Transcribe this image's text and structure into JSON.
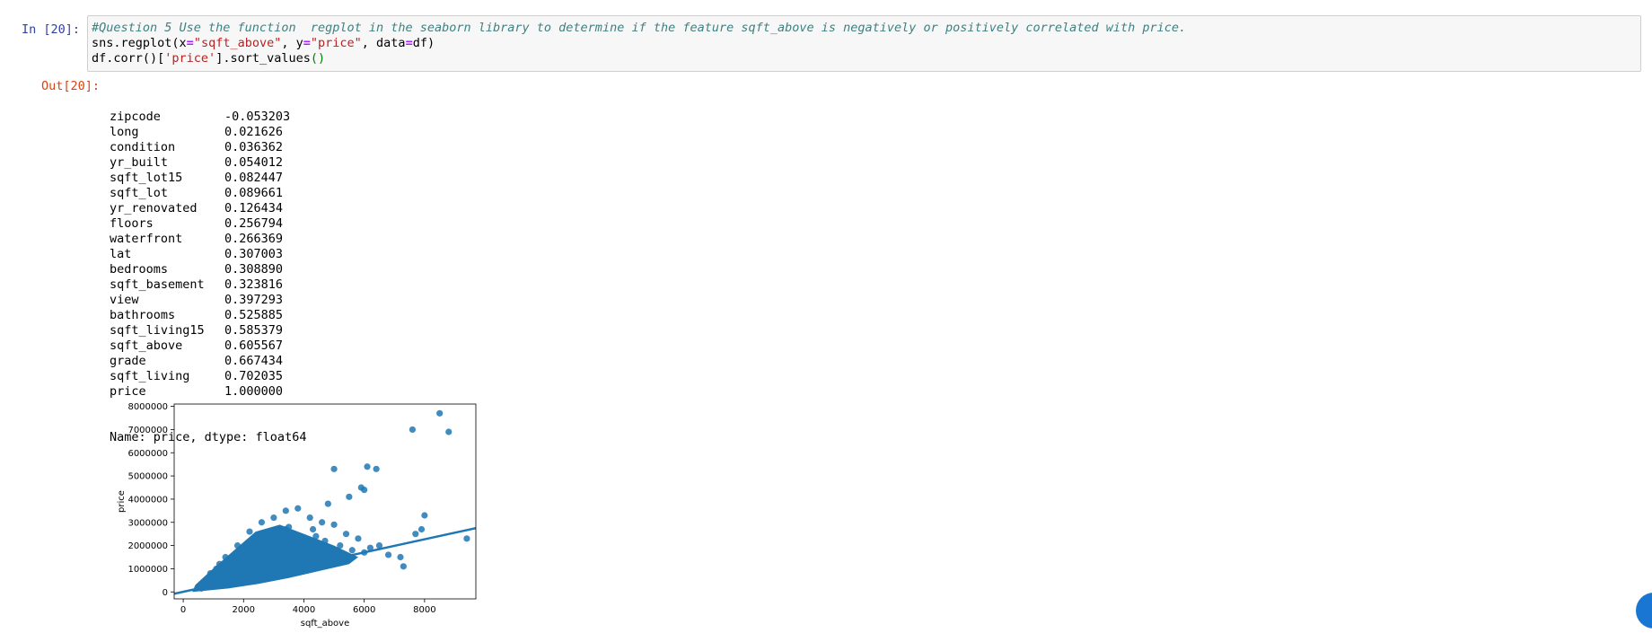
{
  "cell": {
    "in_prompt": "In [20]:",
    "out_prompt": "Out[20]:",
    "code": {
      "comment": "#Question 5 Use the function  regplot in the seaborn library to determine if the feature sqft_above is negatively or positively correlated with price.",
      "line2_a": "sns.regplot(x",
      "line2_eq1": "=",
      "line2_s1": "\"sqft_above\"",
      "line2_b": ", y",
      "line2_eq2": "=",
      "line2_s2": "\"price\"",
      "line2_c": ", data",
      "line2_eq3": "=",
      "line2_d": "df)",
      "line3_a": "df.corr()[",
      "line3_s": "'price'",
      "line3_b": "].sort_values",
      "line3_p": "()"
    }
  },
  "output": {
    "rows": [
      {
        "name": "zipcode",
        "value": "-0.053203"
      },
      {
        "name": "long",
        "value": "0.021626"
      },
      {
        "name": "condition",
        "value": "0.036362"
      },
      {
        "name": "yr_built",
        "value": "0.054012"
      },
      {
        "name": "sqft_lot15",
        "value": "0.082447"
      },
      {
        "name": "sqft_lot",
        "value": "0.089661"
      },
      {
        "name": "yr_renovated",
        "value": "0.126434"
      },
      {
        "name": "floors",
        "value": "0.256794"
      },
      {
        "name": "waterfront",
        "value": "0.266369"
      },
      {
        "name": "lat",
        "value": "0.307003"
      },
      {
        "name": "bedrooms",
        "value": "0.308890"
      },
      {
        "name": "sqft_basement",
        "value": "0.323816"
      },
      {
        "name": "view",
        "value": "0.397293"
      },
      {
        "name": "bathrooms",
        "value": "0.525885"
      },
      {
        "name": "sqft_living15",
        "value": "0.585379"
      },
      {
        "name": "sqft_above",
        "value": "0.605567"
      },
      {
        "name": "grade",
        "value": "0.667434"
      },
      {
        "name": "sqft_living",
        "value": "0.702035"
      },
      {
        "name": "price",
        "value": "1.000000"
      }
    ],
    "footer": "Name: price, dtype: float64"
  },
  "chart_data": {
    "type": "scatter",
    "xlabel": "sqft_above",
    "ylabel": "price",
    "xlim": [
      -300,
      9700
    ],
    "ylim": [
      -300000,
      8100000
    ],
    "x_ticks": [
      0,
      2000,
      4000,
      6000,
      8000
    ],
    "x_tick_labels": [
      "0",
      "2000",
      "4000",
      "6000",
      "8000"
    ],
    "y_ticks": [
      0,
      1000000,
      2000000,
      3000000,
      4000000,
      5000000,
      6000000,
      7000000,
      8000000
    ],
    "y_tick_labels": [
      "0",
      "1000000",
      "2000000",
      "3000000",
      "4000000",
      "5000000",
      "6000000",
      "7000000",
      "8000000"
    ],
    "point_color": "#1f77b4",
    "regression_line": {
      "x": [
        -300,
        9700
      ],
      "y": [
        -80000,
        2750000
      ]
    },
    "points": [
      [
        600,
        150000
      ],
      [
        700,
        200000
      ],
      [
        800,
        250000
      ],
      [
        900,
        300000
      ],
      [
        1000,
        350000
      ],
      [
        1100,
        400000
      ],
      [
        1200,
        500000
      ],
      [
        1300,
        600000
      ],
      [
        1400,
        700000
      ],
      [
        1500,
        800000
      ],
      [
        1600,
        900000
      ],
      [
        1700,
        1000000
      ],
      [
        1800,
        1100000
      ],
      [
        1900,
        1200000
      ],
      [
        2000,
        1300000
      ],
      [
        2100,
        1400000
      ],
      [
        2200,
        1500000
      ],
      [
        2300,
        1600000
      ],
      [
        2400,
        1700000
      ],
      [
        2500,
        1800000
      ],
      [
        2600,
        1900000
      ],
      [
        2700,
        2000000
      ],
      [
        2800,
        2100000
      ],
      [
        2900,
        2200000
      ],
      [
        3000,
        2300000
      ],
      [
        3100,
        2400000
      ],
      [
        3200,
        2500000
      ],
      [
        3300,
        2600000
      ],
      [
        3400,
        2700000
      ],
      [
        3500,
        2800000
      ],
      [
        1500,
        300000
      ],
      [
        2000,
        500000
      ],
      [
        2500,
        700000
      ],
      [
        3000,
        900000
      ],
      [
        3500,
        1100000
      ],
      [
        4000,
        1300000
      ],
      [
        4500,
        1500000
      ],
      [
        5000,
        1700000
      ],
      [
        1800,
        2000000
      ],
      [
        2200,
        2600000
      ],
      [
        2600,
        3000000
      ],
      [
        3000,
        3200000
      ],
      [
        3400,
        3500000
      ],
      [
        3800,
        3600000
      ],
      [
        4200,
        3200000
      ],
      [
        4600,
        3000000
      ],
      [
        5000,
        2900000
      ],
      [
        5400,
        2500000
      ],
      [
        5800,
        2300000
      ],
      [
        6200,
        1900000
      ],
      [
        4800,
        3800000
      ],
      [
        5500,
        4100000
      ],
      [
        5900,
        4500000
      ],
      [
        6100,
        5400000
      ],
      [
        6400,
        5300000
      ],
      [
        5000,
        5300000
      ],
      [
        6000,
        4400000
      ],
      [
        6800,
        1600000
      ],
      [
        7200,
        1500000
      ],
      [
        7300,
        1100000
      ],
      [
        7700,
        2500000
      ],
      [
        7900,
        2700000
      ],
      [
        8000,
        3300000
      ],
      [
        9400,
        2300000
      ],
      [
        7600,
        7000000
      ],
      [
        8500,
        7700000
      ],
      [
        8800,
        6900000
      ],
      [
        4200,
        2100000
      ],
      [
        3700,
        1900000
      ],
      [
        4400,
        2400000
      ],
      [
        1200,
        1200000
      ],
      [
        1400,
        1500000
      ],
      [
        900,
        800000
      ],
      [
        1100,
        1000000
      ],
      [
        2800,
        1300000
      ],
      [
        3200,
        1600000
      ],
      [
        3600,
        1700000
      ],
      [
        4000,
        2000000
      ],
      [
        4300,
        2700000
      ],
      [
        4700,
        2200000
      ],
      [
        5200,
        2000000
      ],
      [
        5600,
        1800000
      ],
      [
        6000,
        1700000
      ],
      [
        6500,
        2000000
      ]
    ]
  }
}
